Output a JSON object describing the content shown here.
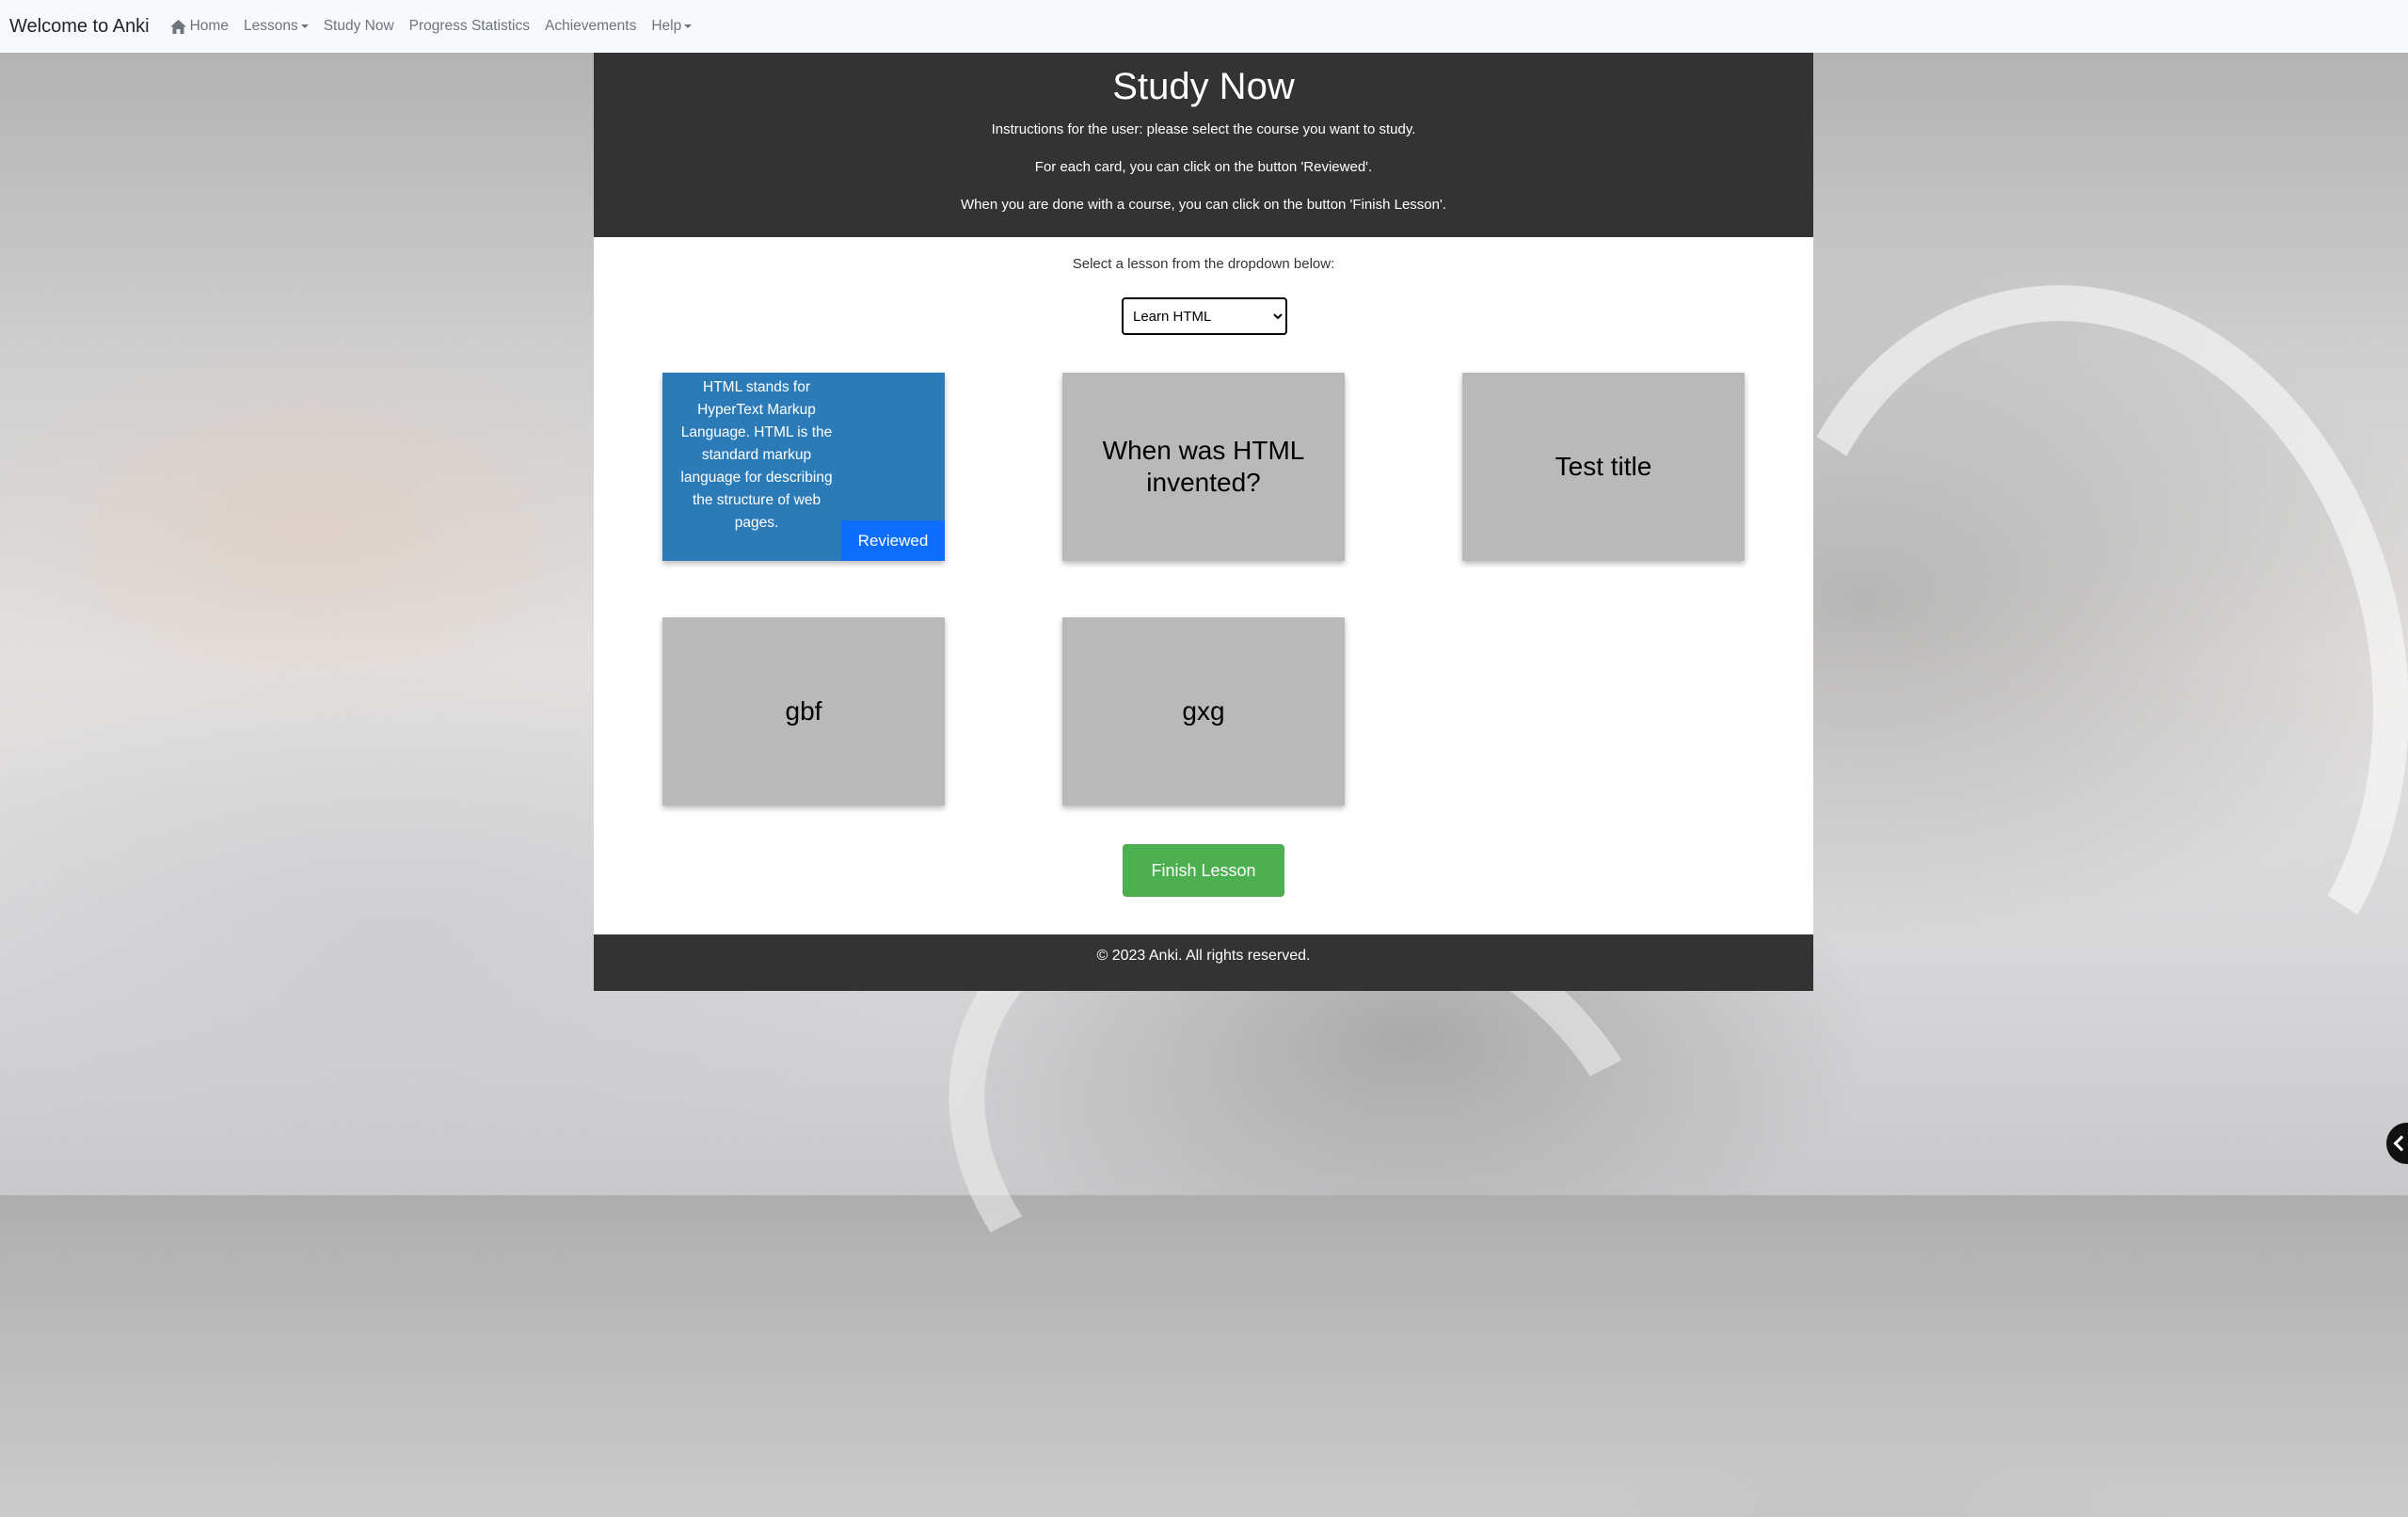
{
  "navbar": {
    "brand": "Welcome to Anki",
    "items": [
      {
        "label": "Home",
        "icon": "home-icon"
      },
      {
        "label": "Lessons",
        "dropdown": true
      },
      {
        "label": "Study Now"
      },
      {
        "label": "Progress Statistics"
      },
      {
        "label": "Achievements"
      },
      {
        "label": "Help",
        "dropdown": true
      }
    ]
  },
  "header": {
    "title": "Study Now",
    "instructions": [
      "Instructions for the user: please select the course you want to study.",
      "For each card, you can click on the button 'Reviewed'.",
      "When you are done with a course, you can click on the button 'Finish Lesson'."
    ]
  },
  "lesson_select": {
    "label": "Select a lesson from the dropdown below:",
    "selected": "Learn HTML"
  },
  "cards": [
    {
      "text": "HTML stands for HyperText Markup Language. HTML is the standard markup language for describing the structure of web pages.",
      "flipped": true,
      "button": "Reviewed"
    },
    {
      "text": "When was HTML invented?"
    },
    {
      "text": "Test title"
    },
    {
      "text": "gbf"
    },
    {
      "text": "gxg"
    }
  ],
  "finish_button": "Finish Lesson",
  "footer": "© 2023 Anki. All rights reserved.",
  "colors": {
    "navbar_bg": "#f8f9fa",
    "header_bg": "#333333",
    "card_bg": "#b9b9b9",
    "card_flipped_bg": "#2b7bb9",
    "reviewed_button": "#0d6efd",
    "finish_button": "#4caf50"
  },
  "icons": {
    "home": "home-icon",
    "floating_button": "chevron-left-icon"
  }
}
